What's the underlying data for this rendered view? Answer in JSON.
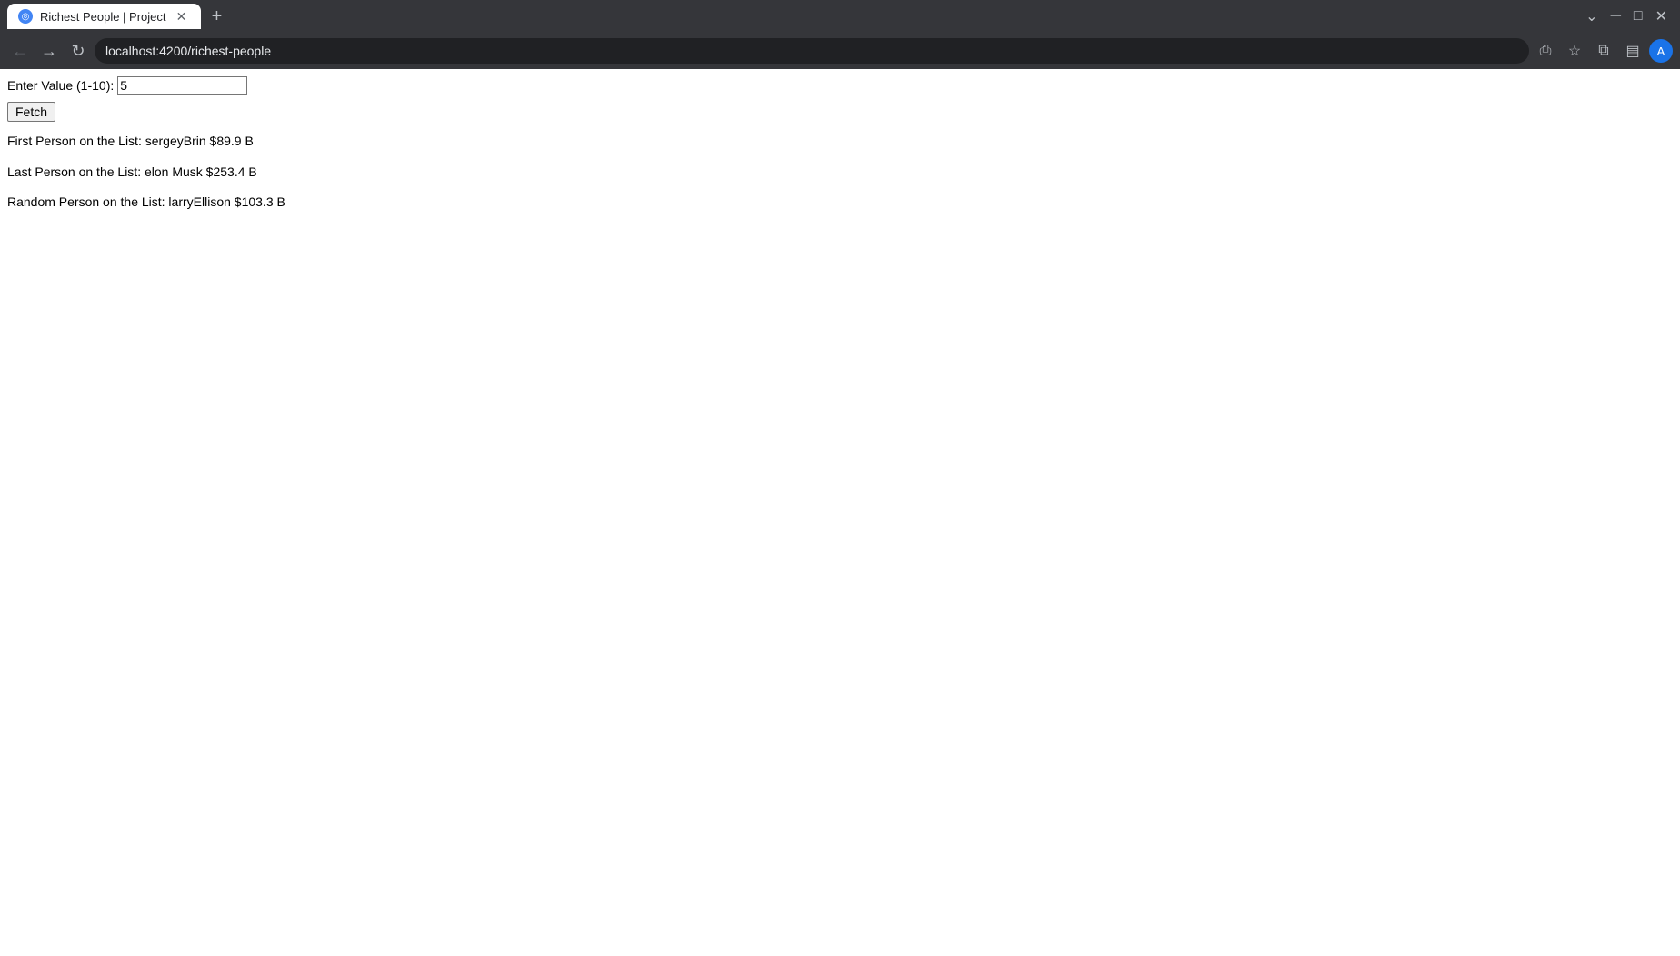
{
  "browser": {
    "tab_title": "Richest People | Project",
    "tab_favicon": "◎",
    "close_icon": "✕",
    "new_tab_icon": "+",
    "minimize_icon": "─",
    "maximize_icon": "□",
    "close_window_icon": "✕",
    "dropdown_icon": "⌄",
    "back_icon": "←",
    "forward_icon": "→",
    "reload_icon": "↻",
    "url": "localhost:4200/richest-people",
    "share_icon": "⎙",
    "bookmark_icon": "☆",
    "extensions_icon": "⧉",
    "sidebar_icon": "▤",
    "profile_letter": "A"
  },
  "page": {
    "input_label": "Enter Value (1-10):",
    "input_value": "5",
    "fetch_button_label": "Fetch",
    "first_person_label": "First Person on the List: sergeyBrin $89.9 B",
    "last_person_label": "Last Person on the List: elon Musk $253.4 B",
    "random_person_label": "Random Person on the List: larryEllison $103.3 B"
  }
}
